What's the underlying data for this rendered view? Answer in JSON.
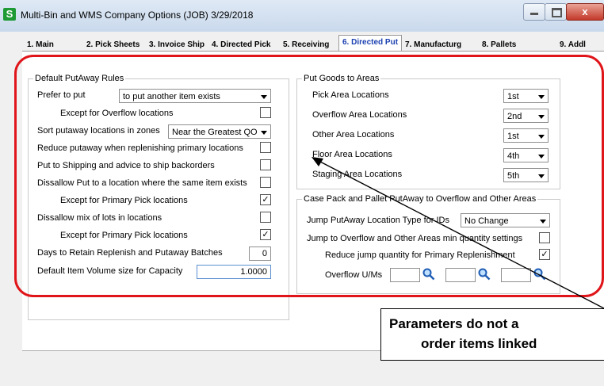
{
  "window": {
    "title": "Multi-Bin and WMS Company Options (JOB) 3/29/2018",
    "app_icon": "S"
  },
  "tabs": [
    {
      "label": "1. Main"
    },
    {
      "label": "2. Pick Sheets"
    },
    {
      "label": "3. Invoice Ship"
    },
    {
      "label": "4. Directed Pick"
    },
    {
      "label": "5. Receiving"
    },
    {
      "label": "6. Directed Put",
      "active": true
    },
    {
      "label": "7. Manufacturg"
    },
    {
      "label": "8. Pallets"
    },
    {
      "label": "9. Addl"
    }
  ],
  "putaway_rules": {
    "title": "Default PutAway Rules",
    "prefer_to_put_label": "Prefer to put",
    "prefer_to_put_value": "to put another item exists",
    "except_overflow_label": "Except for Overflow locations",
    "sort_zones_label": "Sort putaway locations in zones",
    "sort_zones_value": "Near the Greatest QO",
    "reduce_putaway_label": "Reduce putaway when replenishing primary locations",
    "put_to_shipping_label": "Put to Shipping and advice to ship backorders",
    "disallow_put_label": "Dissallow Put to a location where the same item exists",
    "except_primary_1_label": "Except for Primary Pick locations",
    "disallow_mix_label": "Dissallow mix of lots in locations",
    "except_primary_2_label": "Except for Primary Pick locations",
    "days_retain_label": "Days to Retain Replenish and Putaway Batches",
    "days_retain_value": "0",
    "volume_label": "Default Item Volume size for Capacity",
    "volume_value": "1.0000",
    "checkboxes": {
      "except_overflow": false,
      "reduce_putaway": false,
      "put_to_shipping": false,
      "disallow_put": false,
      "except_primary_1": true,
      "disallow_mix": false,
      "except_primary_2": true
    }
  },
  "areas": {
    "title": "Put Goods to Areas",
    "rows": [
      {
        "label": "Pick Area Locations",
        "value": "1st"
      },
      {
        "label": "Overflow Area Locations",
        "value": "2nd"
      },
      {
        "label": "Other Area Locations",
        "value": "1st"
      },
      {
        "label": "Floor Area Locations",
        "value": "4th"
      },
      {
        "label": "Staging Area Locations",
        "value": "5th"
      }
    ]
  },
  "case_pack": {
    "title": "Case Pack and Pallet PutAway to Overflow and Other Areas",
    "jump_type_label": "Jump PutAway Location Type for IDs",
    "jump_type_value": "No Change",
    "jump_overflow_label": "Jump to Overflow and Other Areas min quantity settings",
    "reduce_jump_label": "Reduce jump quantity for Primary Replenishment",
    "overflow_uom_label": "Overflow U/Ms",
    "checkboxes": {
      "jump_overflow": false,
      "reduce_jump": true
    }
  },
  "callout": {
    "line1": "Parameters do not a",
    "line2": "order items linked"
  },
  "checkmark": "✓",
  "colors": {
    "highlight": "#e0151a",
    "active_tab": "#1a3fb0",
    "app_icon": "#1e9a35"
  }
}
